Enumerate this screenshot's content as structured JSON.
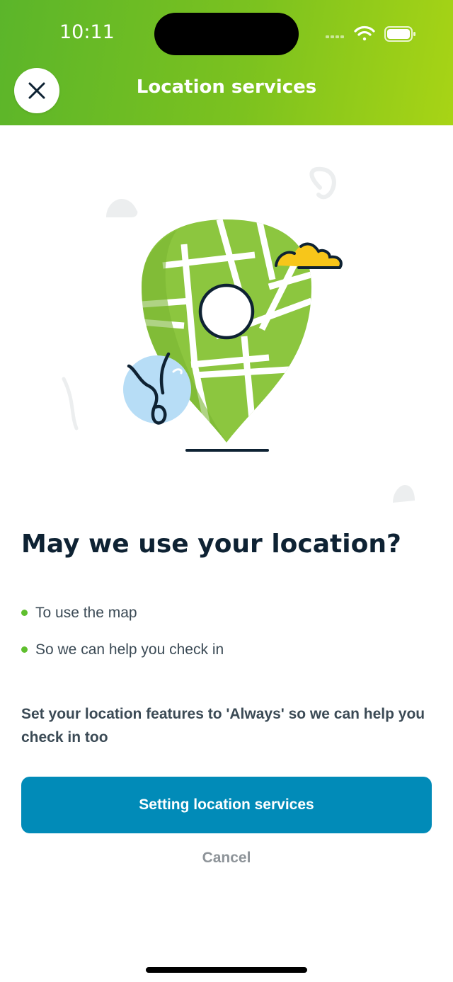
{
  "status_bar": {
    "time": "10:11"
  },
  "header": {
    "title": "Location services",
    "close_icon": "close-icon"
  },
  "illustration": {
    "icon": "map-pin-illustration",
    "colors": {
      "pin": "#8cc63f",
      "cloud": "#f7c61a",
      "globe": "#b7ddf6"
    }
  },
  "main": {
    "heading": "May we use your location?",
    "bullets": [
      "To use the map",
      "So we can help you check in"
    ],
    "note": "Set your location features to 'Always' so we can help you check in too"
  },
  "actions": {
    "primary_label": "Setting location services",
    "cancel_label": "Cancel"
  },
  "colors": {
    "header_start": "#5bb52a",
    "header_end": "#a8d415",
    "primary": "#018bb8",
    "accent_dot": "#5fbf2e",
    "text_dark": "#0e2233"
  }
}
